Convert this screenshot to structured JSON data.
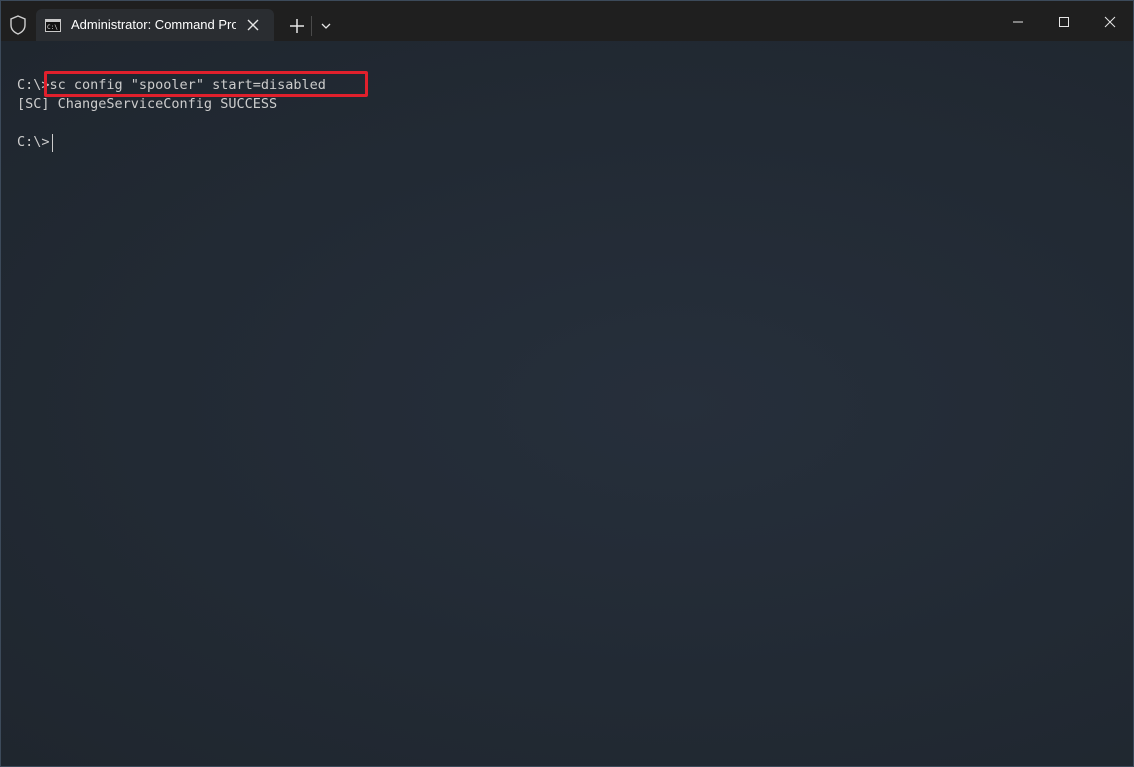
{
  "window": {
    "tab_title": "Administrator: Command Prompt",
    "icons": {
      "shield": "shield-icon",
      "tab": "cmd-icon",
      "close_tab": "close-icon",
      "new_tab": "plus-icon",
      "dropdown": "chevron-down-icon",
      "minimize": "minimize-icon",
      "maximize": "maximize-icon",
      "close": "close-icon"
    }
  },
  "terminal": {
    "prompt": "C:\\>",
    "command": "sc config \"spooler\" start=disabled",
    "output": "[SC] ChangeServiceConfig SUCCESS",
    "prompt2": "C:\\>",
    "highlight_color": "#e0202c"
  }
}
